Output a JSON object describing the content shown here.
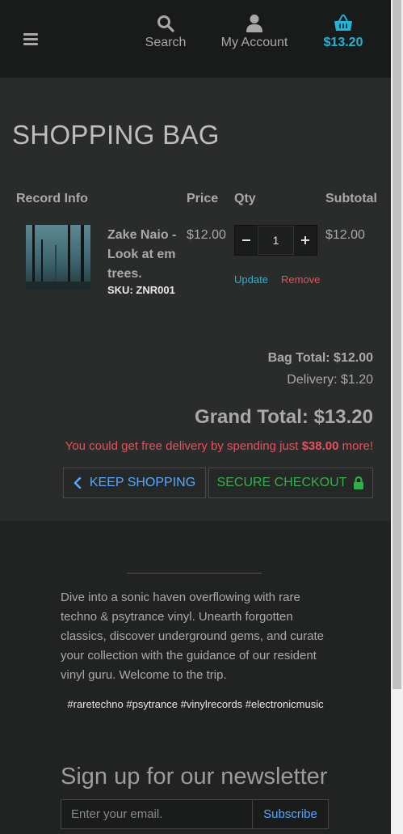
{
  "header": {
    "search_label": "Search",
    "account_label": "My Account",
    "cart_total": "$13.20"
  },
  "bag": {
    "title": "SHOPPING BAG",
    "columns": [
      "Record Info",
      "Price",
      "Qty",
      "Subtotal"
    ],
    "items": [
      {
        "name": "Zake Naio - Look at em trees.",
        "sku": "SKU: ZNR001",
        "price": "$12.00",
        "quantity": "1",
        "subtotal": "$12.00",
        "update_label": "Update",
        "remove_label": "Remove"
      }
    ],
    "bag_total": "Bag Total: $12.00",
    "delivery": "Delivery: $1.20",
    "grand_total": "Grand Total: $13.20",
    "free_delivery_prefix": "You could get free delivery by spending just ",
    "free_delivery_amount": "$38.00",
    "free_delivery_suffix": " more!",
    "keep_shopping_label": "KEEP SHOPPING",
    "secure_checkout_label": "SECURE CHECKOUT"
  },
  "footer": {
    "about": "Dive into a sonic haven overflowing with rare techno & psytrance vinyl. Unearth forgotten classics, discover underground gems, and curate your collection with the guidance of our resident vinyl guru. Welcome to the trip.",
    "tags": "#raretechno #psytrance #vinylrecords #electronicmusic",
    "newsletter_title": "Sign up for our newsletter",
    "email_placeholder": "Enter your email.",
    "subscribe_label": "Subscribe"
  },
  "colors": {
    "accent": "#1eb6d6",
    "danger": "#e8505a",
    "success": "#2fb14a",
    "link": "#56a8ff"
  },
  "icons": [
    "menu-icon",
    "search-icon",
    "user-icon",
    "basket-icon",
    "chevron-left-icon",
    "lock-icon"
  ]
}
